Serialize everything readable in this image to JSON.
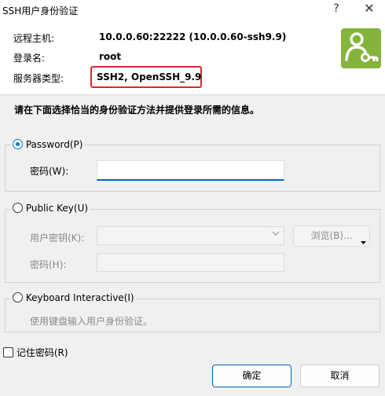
{
  "window": {
    "title": "SSH用户身份验证",
    "help_glyph": "?",
    "close_glyph": "✕"
  },
  "info": {
    "remote_host_label": "远程主机:",
    "remote_host_value": "10.0.0.60:22222 (10.0.0.60-ssh9.9)",
    "login_name_label": "登录名:",
    "login_name_value": "root",
    "server_type_label": "服务器类型:",
    "server_type_value": "SSH2, OpenSSH_9.9"
  },
  "instruction": "请在下面选择恰当的身份验证方法并提供登录所需的信息。",
  "methods": {
    "password": {
      "label": "Password(P)",
      "selected": true,
      "field_label": "密码(W):",
      "field_value": ""
    },
    "public_key": {
      "label": "Public Key(U)",
      "selected": false,
      "user_key_label": "用户密钥(K):",
      "browse_label": "浏览(B)...",
      "passphrase_label": "密码(H):"
    },
    "keyboard": {
      "label": "Keyboard Interactive(I)",
      "selected": false,
      "description": "使用键盘输入用户身份验证。"
    }
  },
  "remember_password": {
    "label": "记住密码(R)",
    "checked": false
  },
  "buttons": {
    "ok": "确定",
    "cancel": "取消"
  },
  "colors": {
    "accent": "#0067c0",
    "logo_bg": "#84b43b",
    "highlight": "#e0262c"
  },
  "icons": {
    "logo": "user-key-icon",
    "combo_arrow": "chevron-down-icon"
  }
}
